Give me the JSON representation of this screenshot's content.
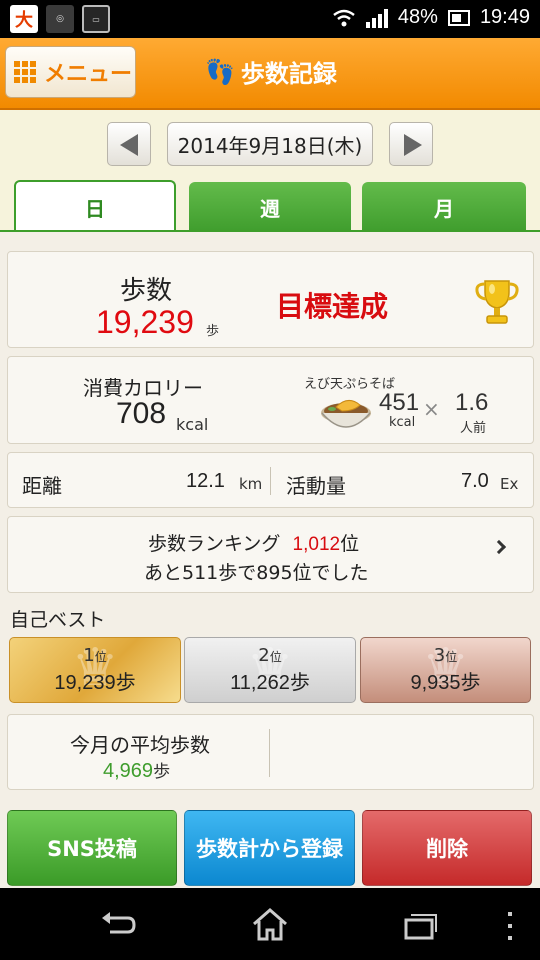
{
  "status_bar": {
    "battery": "48%",
    "time": "19:49",
    "icons": [
      "app-notification-icon",
      "location-off-icon",
      "tv-icon",
      "wifi-icon",
      "signal-icon",
      "battery-icon"
    ]
  },
  "header": {
    "menu_label": "メニュー",
    "title": "歩数記録"
  },
  "date_nav": {
    "date": "2014年9月18日(木)"
  },
  "tabs": [
    {
      "label": "日",
      "active": true
    },
    {
      "label": "週",
      "active": false
    },
    {
      "label": "月",
      "active": false
    }
  ],
  "steps": {
    "label": "歩数",
    "value": "19,239",
    "unit": "歩",
    "goal_status": "目標達成"
  },
  "calories": {
    "label": "消費カロリー",
    "value": "708",
    "unit": "kcal",
    "food_name": "えび天ぷらそば",
    "food_kcal": "451",
    "food_kcal_unit": "kcal",
    "times": "×",
    "servings": "1.6",
    "servings_unit": "人前"
  },
  "distance": {
    "label": "距離",
    "value": "12.1",
    "unit": "km"
  },
  "activity": {
    "label": "活動量",
    "value": "7.0",
    "unit": "Ex"
  },
  "ranking": {
    "prefix": "歩数ランキング",
    "rank_number": "1,012",
    "rank_suffix": "位",
    "line2": "あと511歩で895位でした"
  },
  "personal_best": {
    "title": "自己ベスト",
    "entries": [
      {
        "rank": "1",
        "rank_unit": "位",
        "value": "19,239歩"
      },
      {
        "rank": "2",
        "rank_unit": "位",
        "value": "11,262歩"
      },
      {
        "rank": "3",
        "rank_unit": "位",
        "value": "9,935歩"
      }
    ]
  },
  "monthly_average": {
    "label": "今月の平均歩数",
    "value": "4,969",
    "unit": "歩"
  },
  "actions": {
    "sns": "SNS投稿",
    "register": "歩数計から登録",
    "delete": "削除"
  },
  "colors": {
    "header_orange": "#f28a00",
    "green": "#3f9d2d",
    "red": "#d80c10",
    "blue": "#0c88d0"
  }
}
